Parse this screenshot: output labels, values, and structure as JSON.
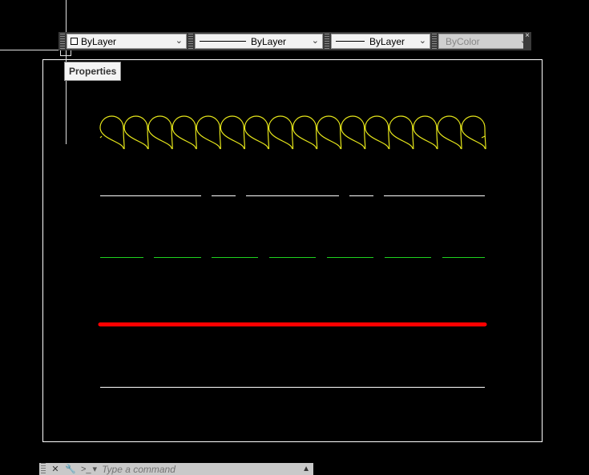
{
  "toolbar": {
    "color_value": "ByLayer",
    "linetype_value": "ByLayer",
    "lineweight_value": "ByLayer",
    "plotstyle_value": "ByColor",
    "close_glyph": "×"
  },
  "tooltip": {
    "text": "Properties"
  },
  "command_line": {
    "placeholder": "Type a command",
    "close_glyph": "✕",
    "customize_glyph": "🔧",
    "prompt_glyph": ">_",
    "history_glyph": "▾",
    "expand_glyph": "▲"
  },
  "colors": {
    "background": "#000000",
    "insulation_line": "#e6e61a",
    "dashed_white": "#ffffff",
    "dashed_green": "#1fd11f",
    "thick_red": "#ff0000",
    "thin_white": "#ffffff",
    "frame": "#ffffff"
  },
  "drawing": {
    "insulation_loops": 16,
    "lines": [
      {
        "name": "insulation-linetype",
        "color": "yellow"
      },
      {
        "name": "long-dash-linetype",
        "color": "white"
      },
      {
        "name": "dashed-linetype",
        "color": "green"
      },
      {
        "name": "heavy-lineweight-line",
        "color": "red"
      },
      {
        "name": "continuous-line",
        "color": "white"
      }
    ]
  }
}
